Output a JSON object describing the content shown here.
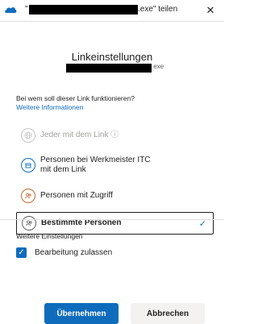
{
  "titlebar": {
    "quote_open": "\"",
    "title_suffix": ".exe\" teilen",
    "close_label": "✕"
  },
  "dialog": {
    "heading": "Linkeinstellungen",
    "file_ext": ".exe",
    "question": "Bei wem soll dieser Link funktionieren?",
    "more_info": "Weitere Informationen",
    "options": [
      {
        "label": "Jeder mit dem Link ⓘ",
        "state": "disabled"
      },
      {
        "label": "Personen bei Werkmeister ITC\nmit dem Link",
        "state": "normal"
      },
      {
        "label": "Personen mit Zugriff",
        "state": "normal"
      },
      {
        "label": "Bestimmte Personen",
        "state": "selected"
      }
    ],
    "further_settings": "Weitere Einstellungen",
    "allow_edit_label": "Bearbeitung zulassen",
    "allow_edit_checked": true,
    "apply_button": "Übernehmen",
    "cancel_button": "Abbrechen"
  },
  "colors": {
    "accent": "#0f6cbd",
    "text": "#201f1e",
    "disabled": "#a19f9d"
  }
}
